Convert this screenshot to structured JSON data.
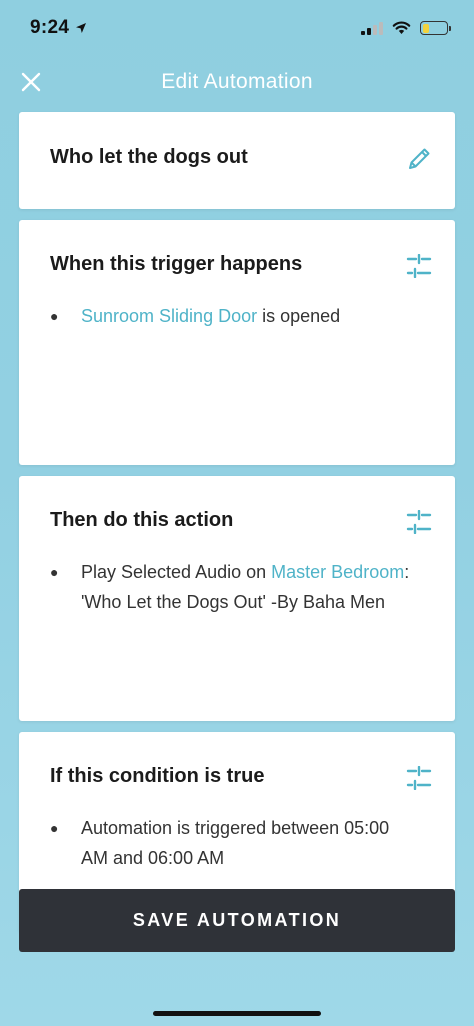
{
  "status_bar": {
    "time": "9:24"
  },
  "nav": {
    "title": "Edit Automation"
  },
  "name_card": {
    "title": "Who let the dogs out"
  },
  "trigger_card": {
    "title": "When this trigger happens",
    "device": "Sunroom Sliding Door",
    "event_text": "is opened"
  },
  "action_card": {
    "title": "Then do this action",
    "prefix": "Play Selected Audio on",
    "room": "Master Bedroom",
    "suffix": ": 'Who Let the Dogs Out' -By Baha Men"
  },
  "condition_card": {
    "title": "If this condition is true",
    "text": "Automation is triggered between 05:00 AM and 06:00 AM"
  },
  "save_button": {
    "label": "SAVE AUTOMATION"
  },
  "colors": {
    "accent": "#4fb3c8",
    "background": "#92d0e2",
    "button": "#2f3238"
  }
}
